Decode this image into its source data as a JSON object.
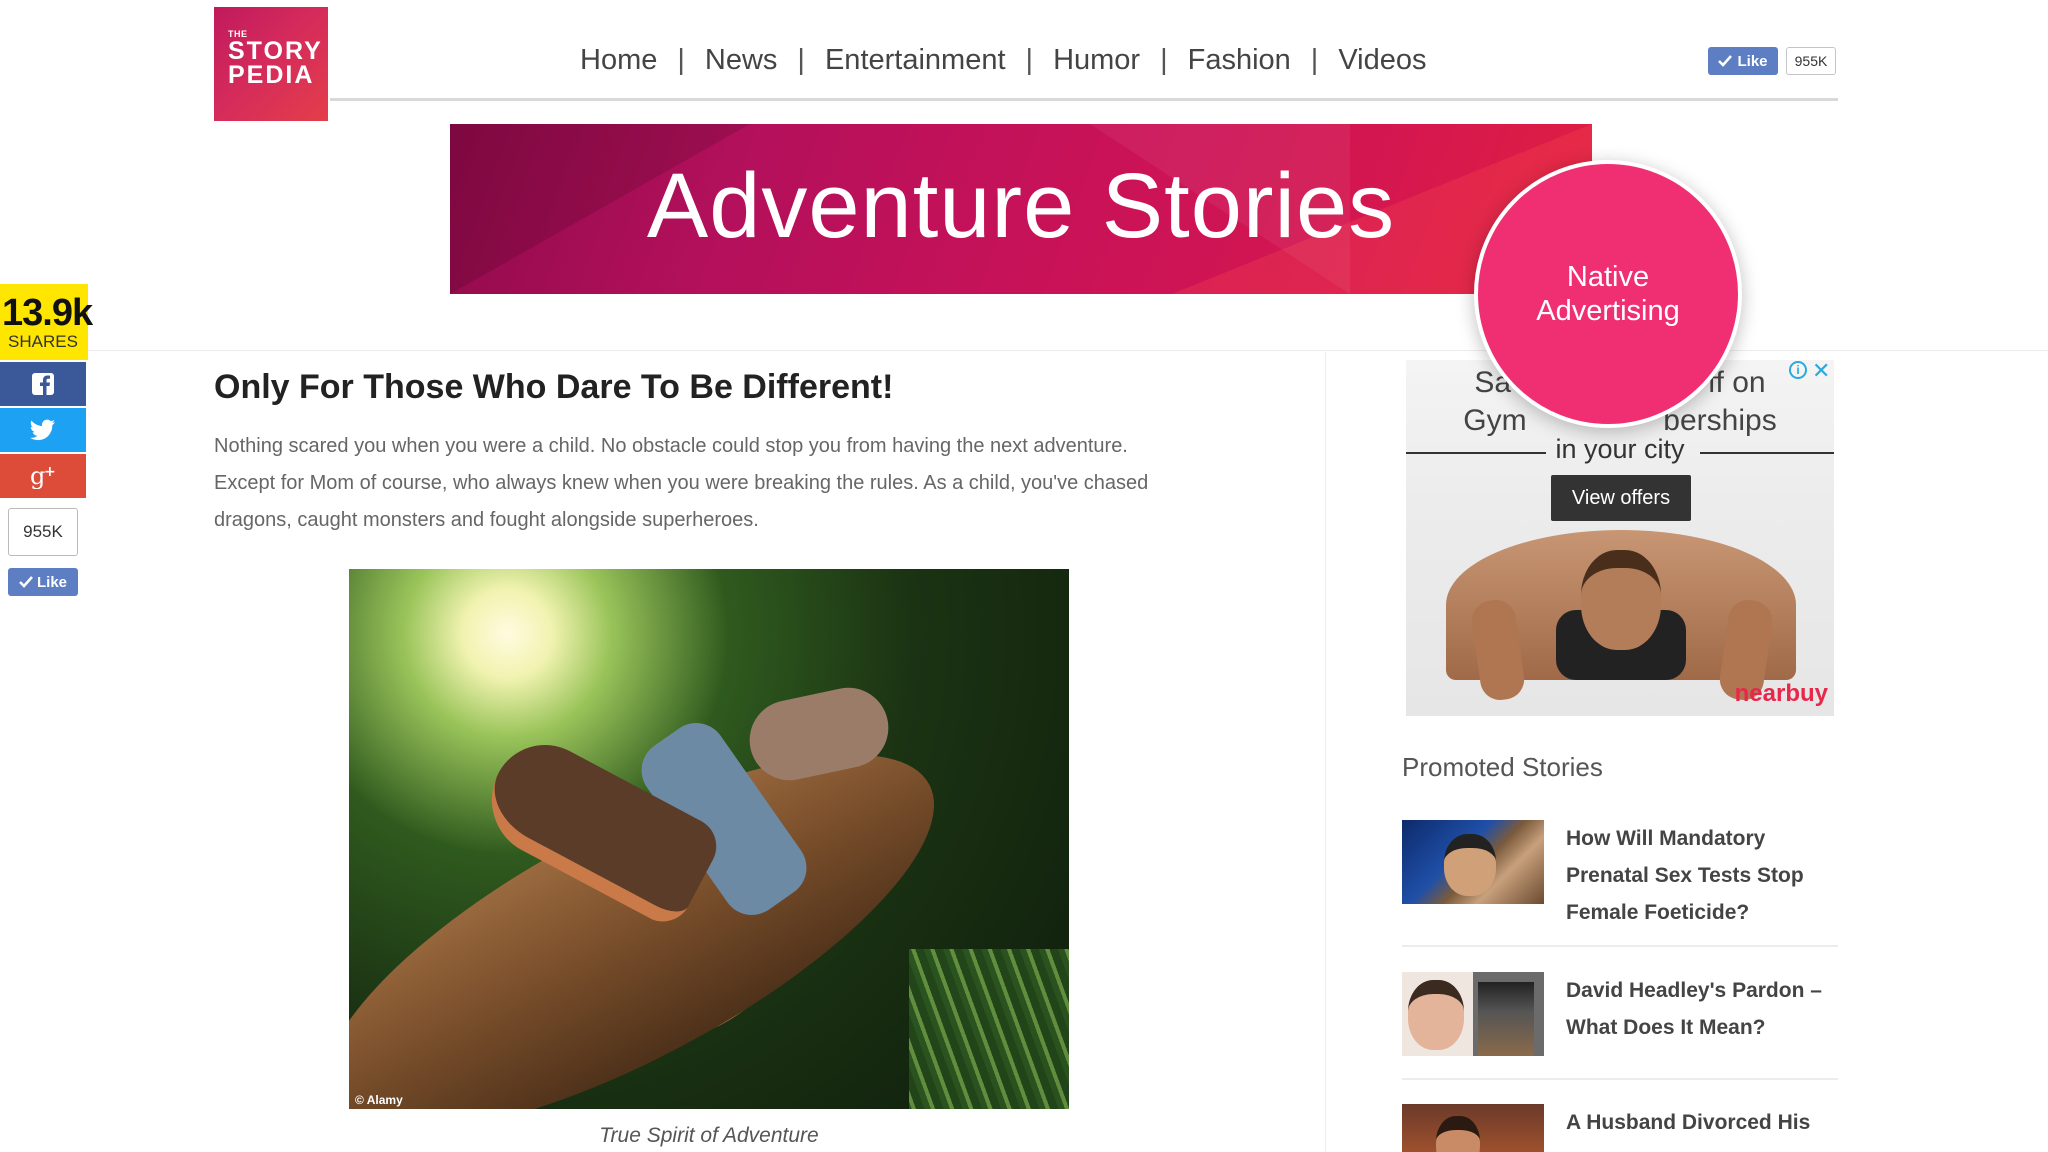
{
  "logo": {
    "line1": "THE",
    "line2": "STORY",
    "line3": "PEDIA"
  },
  "nav": {
    "items": [
      "Home",
      "News",
      "Entertainment",
      "Humor",
      "Fashion",
      "Videos"
    ],
    "separator": "|"
  },
  "facebook": {
    "like_label": "Like",
    "count": "955K"
  },
  "banner": {
    "title": "Adventure Stories"
  },
  "native_badge": {
    "line1": "Native",
    "line2": "Advertising"
  },
  "share_bar": {
    "count": "13.9k",
    "label": "SHARES",
    "like_count": "955K",
    "like_label": "Like",
    "buttons": [
      "facebook-icon",
      "twitter-icon",
      "google-plus-icon"
    ]
  },
  "article": {
    "title": "Only For Those Who Dare To Be Different!",
    "body": "Nothing scared you when you were a child. No obstacle could stop you from having the next adventure. Except for Mom of course, who always knew when you were breaking the rules. As a child, you've chased dragons, caught monsters and fought alongside superheroes.",
    "image_credit": "© Alamy",
    "caption": "True Spirit of Adventure"
  },
  "ad": {
    "line1": "Sa",
    "line1_end": "ff on",
    "line2_start": "Gym",
    "line2_end": "berships",
    "line3": "in your city",
    "cta": "View offers",
    "brand": "nearbuy",
    "info_icon": "i",
    "close_icon": "✕"
  },
  "promoted": {
    "heading": "Promoted Stories",
    "items": [
      {
        "title": "How Will Mandatory Prenatal Sex Tests Stop Female Foeticide?"
      },
      {
        "title": "David Headley's Pardon – What Does It Mean?"
      },
      {
        "title": "A Husband Divorced His"
      }
    ]
  },
  "colors": {
    "brand_pink": "#f02f72",
    "banner_magenta": "#b3105b",
    "facebook_blue": "#3b5998",
    "twitter_blue": "#1da1f2",
    "google_red": "#dd4b39",
    "share_yellow": "#ffe600"
  }
}
